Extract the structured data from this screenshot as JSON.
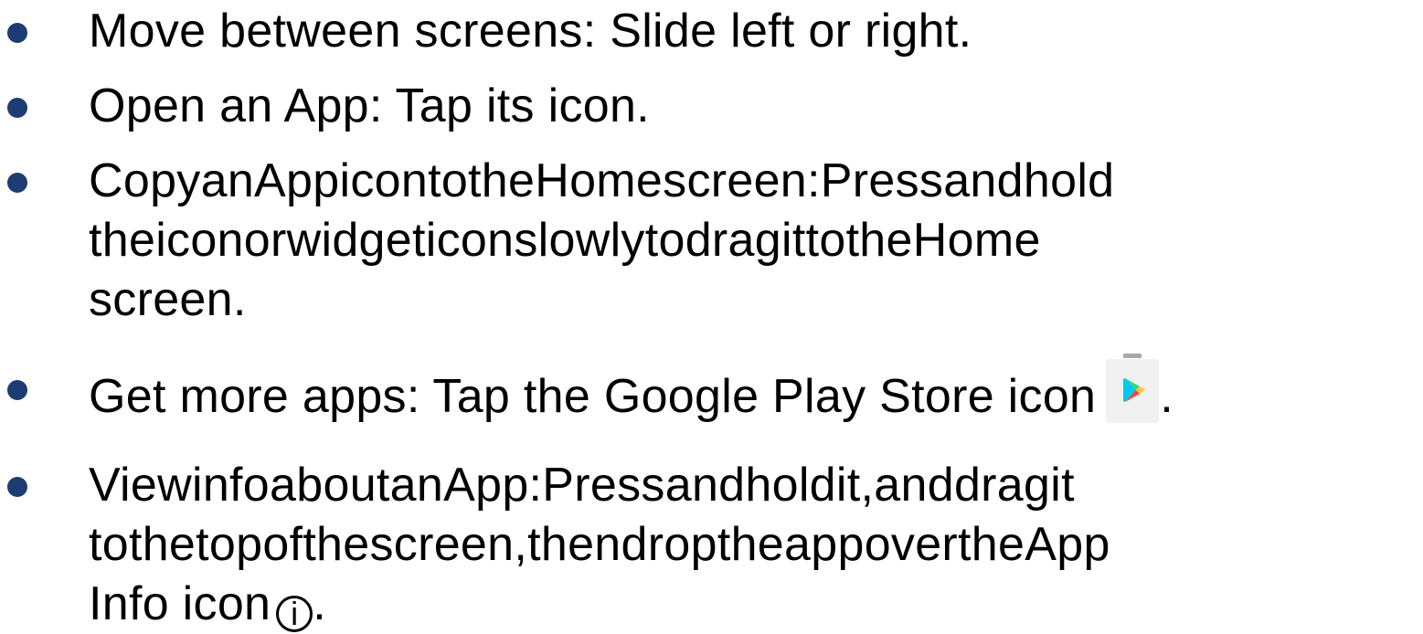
{
  "colors": {
    "bullet": "#1d3c73",
    "text": "#000000",
    "play_bag": "#f1f1f1",
    "play_handle": "#a8a8a8"
  },
  "items": [
    {
      "lines": [
        "Move between screens: Slide left or right."
      ]
    },
    {
      "lines": [
        "Open an App: Tap its icon."
      ]
    },
    {
      "lines_justified": [
        [
          "Copy",
          "an",
          "App",
          "icon",
          "to",
          "the",
          "Home",
          "screen:",
          "Press",
          "and",
          "hold"
        ],
        [
          "the",
          "icon",
          "or",
          "widget",
          "icon",
          "slowly",
          "to",
          "drag",
          "it",
          "to",
          "the",
          "Home"
        ]
      ],
      "last_line": "screen."
    },
    {
      "text_before_icon": "Get more apps: Tap the Google Play Store icon",
      "icon": "google-play-store-icon",
      "text_after_icon": "."
    },
    {
      "lines_justified": [
        [
          "View",
          "info",
          "about",
          "an",
          "App:",
          "Press",
          "and",
          "hold",
          "it,",
          "and",
          "drag",
          "it"
        ],
        [
          "to",
          "the",
          "top",
          "of",
          "the",
          "screen,",
          "then",
          "drop",
          "the",
          "app",
          "over",
          "the",
          "App"
        ]
      ],
      "last_line_before_icon": "Info icon",
      "icon": "info-icon",
      "icon_glyph": "i",
      "last_line_after_icon": "."
    }
  ]
}
